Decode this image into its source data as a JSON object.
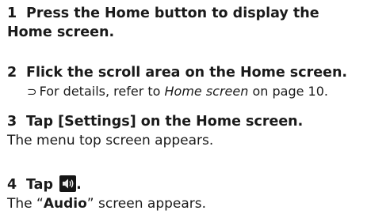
{
  "steps": [
    {
      "number": "1",
      "title_line1": "Press the Home button to display the",
      "title_line2": "Home screen."
    },
    {
      "number": "2",
      "title": "Flick the scroll area on the Home screen.",
      "note": {
        "arrow": "⊃",
        "prefix": "For details, refer to ",
        "ref": "Home screen",
        "suffix": " on page 10."
      }
    },
    {
      "number": "3",
      "title": "Tap [Settings] on the Home screen.",
      "result": "The menu top screen appears."
    },
    {
      "number": "4",
      "title": "Tap",
      "icon": "speaker-volume-icon",
      "title_end": ".",
      "result_prefix": "The “",
      "result_bold": "Audio",
      "result_suffix": "” screen appears."
    }
  ]
}
